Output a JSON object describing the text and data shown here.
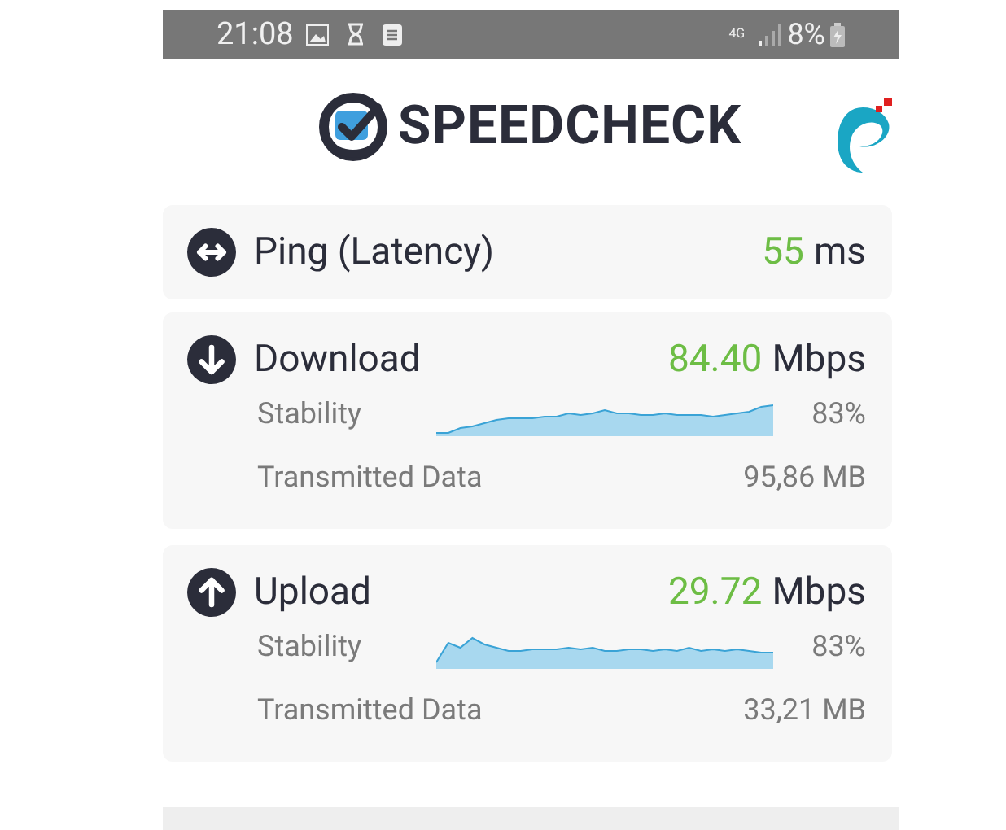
{
  "status_bar": {
    "time": "21:08",
    "network": "4G",
    "battery": "8%"
  },
  "header": {
    "logo_text": "SPEEDCHECK"
  },
  "results": [
    {
      "kind": "ping",
      "title": "Ping (Latency)",
      "value": "55",
      "unit": "ms"
    },
    {
      "kind": "download",
      "title": "Download",
      "value": "84.40",
      "unit": "Mbps",
      "stability_label": "Stability",
      "stability": "83%",
      "data_label": "Transmitted Data",
      "data": "95,86 MB"
    },
    {
      "kind": "upload",
      "title": "Upload",
      "value": "29.72",
      "unit": "Mbps",
      "stability_label": "Stability",
      "stability": "83%",
      "data_label": "Transmitted Data",
      "data": "33,21 MB"
    }
  ]
}
